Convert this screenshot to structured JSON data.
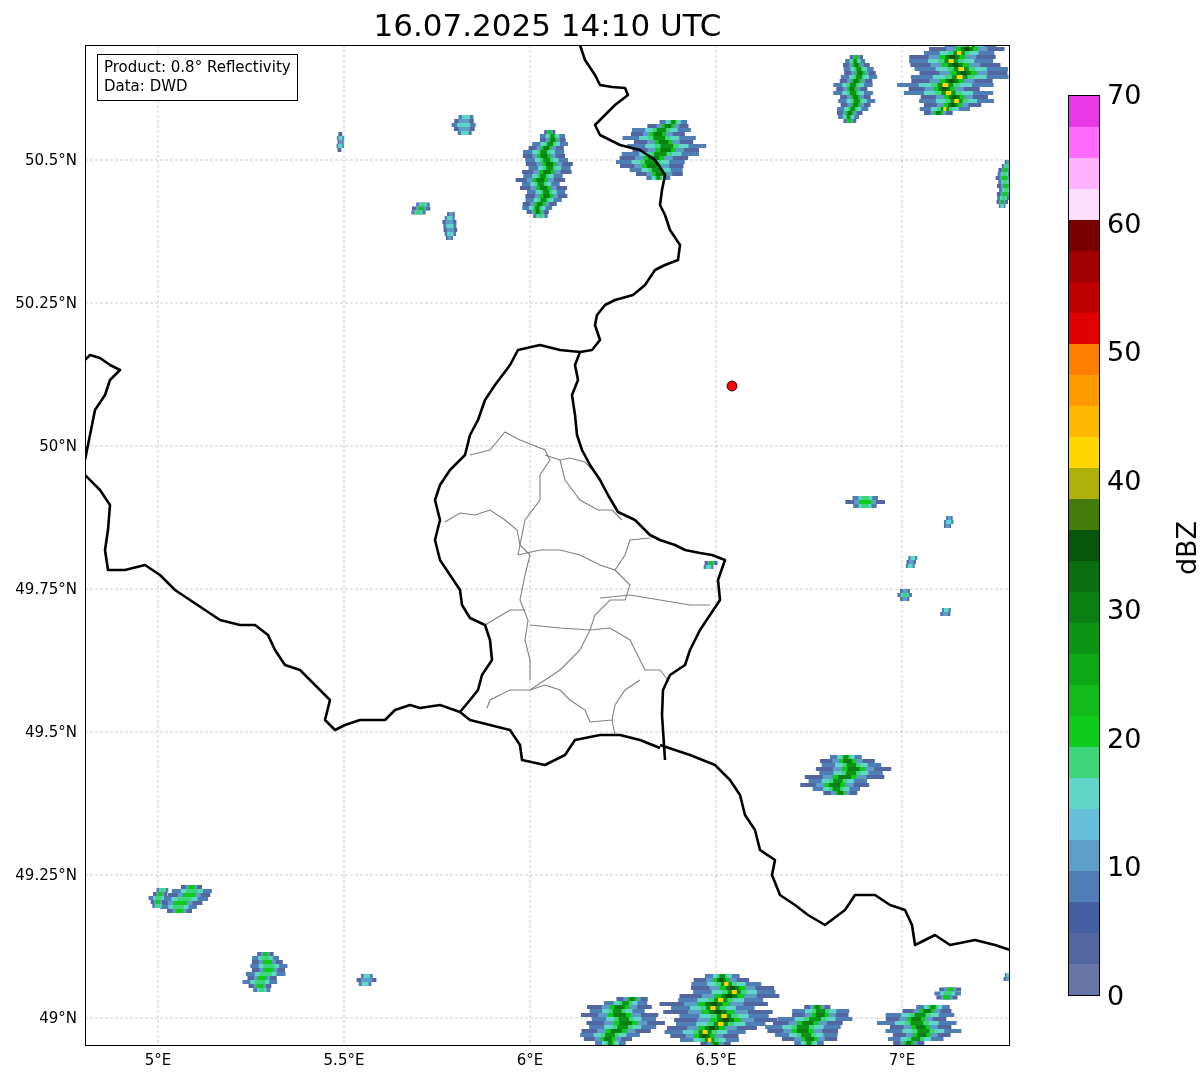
{
  "title": "16.07.2025 14:10 UTC",
  "map": {
    "info_box": [
      "Product: 0.8° Reflectivity",
      "Data: DWD"
    ],
    "yticks": [
      "50.5°N",
      "50.25°N",
      "50°N",
      "49.75°N",
      "49.5°N",
      "49.25°N",
      "49°N"
    ],
    "xticks": [
      "5°E",
      "5.5°E",
      "6°E",
      "6.5°E",
      "7°E"
    ]
  },
  "colorbar": {
    "label": "dBZ",
    "ticks": [
      "70",
      "60",
      "50",
      "40",
      "30",
      "20",
      "10",
      "0"
    ],
    "segments": [
      {
        "color": "#e838e8"
      },
      {
        "color": "#ff6aff"
      },
      {
        "color": "#ffb0ff"
      },
      {
        "color": "#ffddff"
      },
      {
        "color": "#7a0000"
      },
      {
        "color": "#a00000"
      },
      {
        "color": "#c00000"
      },
      {
        "color": "#e00000"
      },
      {
        "color": "#ff7f00"
      },
      {
        "color": "#ff9a00"
      },
      {
        "color": "#ffb700"
      },
      {
        "color": "#ffd700"
      },
      {
        "color": "#b0b00a"
      },
      {
        "color": "#457b0a"
      },
      {
        "color": "#07560c"
      },
      {
        "color": "#086e10"
      },
      {
        "color": "#0a7f12"
      },
      {
        "color": "#0c9414"
      },
      {
        "color": "#0ea816"
      },
      {
        "color": "#10bb18"
      },
      {
        "color": "#10cc1a"
      },
      {
        "color": "#3ed67a"
      },
      {
        "color": "#60d6c8"
      },
      {
        "color": "#67c0dc"
      },
      {
        "color": "#5d9ec8"
      },
      {
        "color": "#4f7db5"
      },
      {
        "color": "#4460a2"
      },
      {
        "color": "#5267a0"
      },
      {
        "color": "#6475a6"
      }
    ]
  }
}
